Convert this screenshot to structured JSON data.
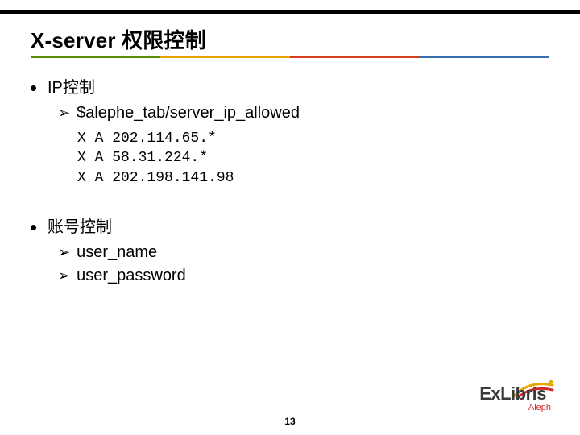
{
  "title": "X-server 权限控制",
  "bullets": [
    {
      "label": "IP控制",
      "sub": [
        "$alephe_tab/server_ip_allowed"
      ],
      "code": "X A 202.114.65.*\nX A 58.31.224.*\nX A 202.198.141.98"
    },
    {
      "label": "账号控制",
      "sub": [
        "user_name",
        "user_password"
      ]
    }
  ],
  "page_number": "13",
  "logo": {
    "brand": "ExLibris",
    "product": "Aleph"
  }
}
